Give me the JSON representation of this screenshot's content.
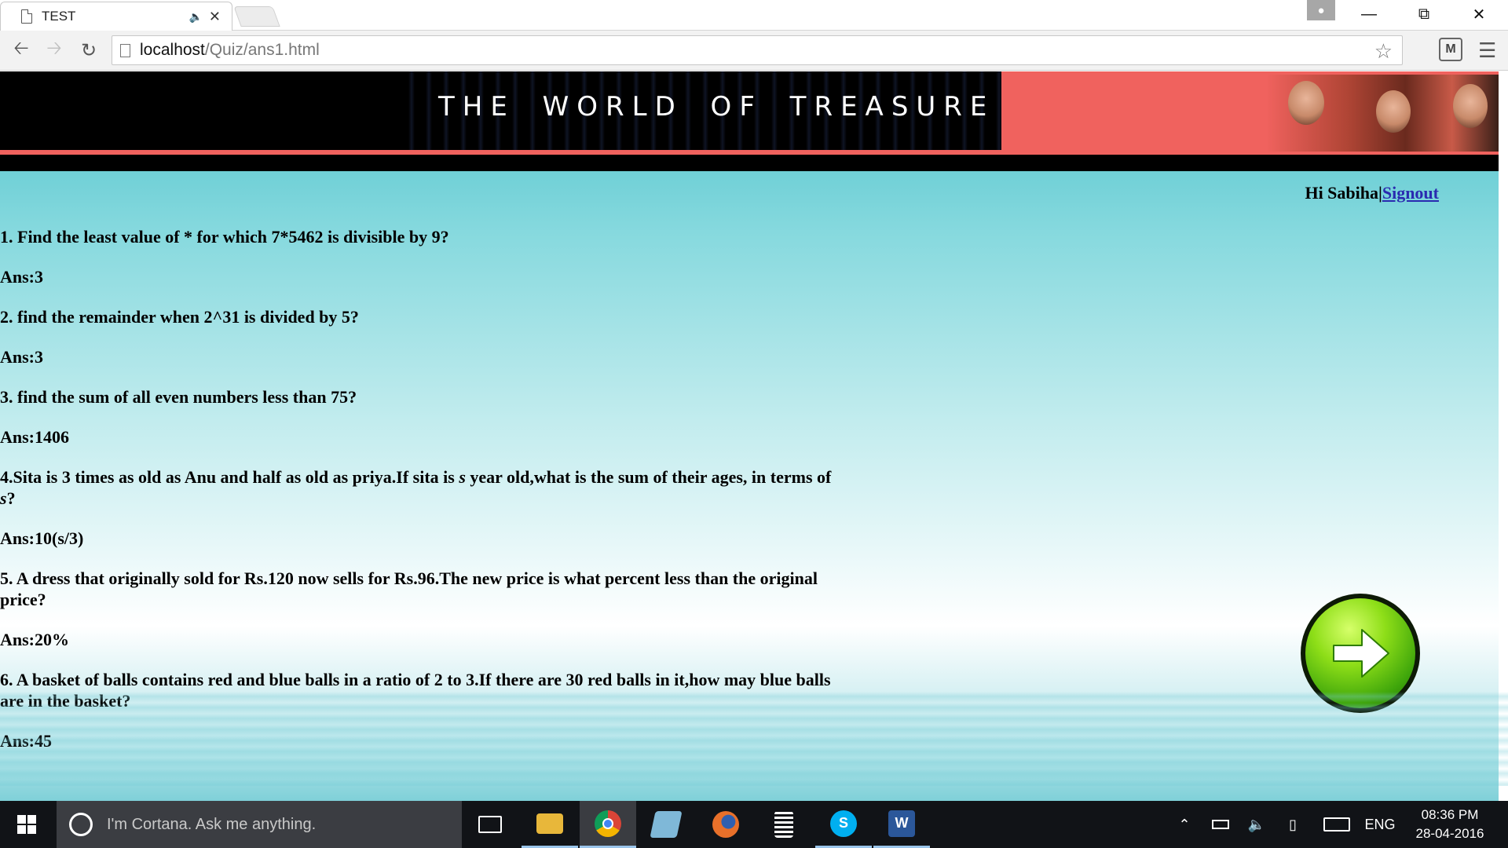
{
  "browser": {
    "tab_title": "TEST",
    "url_host": "localhost",
    "url_path": "/Quiz/ans1.html"
  },
  "site": {
    "title": "THE WORLD OF TREASURE",
    "greeting": "Hi Sabiha|",
    "signout": "Signout"
  },
  "questions": [
    {
      "q": "1. Find the least value of * for which 7*5462 is divisible by 9?",
      "a": "Ans:3"
    },
    {
      "q": "2. find the remainder when 2^31 is divided by 5?",
      "a": "Ans:3"
    },
    {
      "q": "3. find the sum of all even numbers less than 75?",
      "a": "Ans:1406"
    },
    {
      "q1": "4.Sita is 3 times as old as Anu and half as old as priya.If sita is ",
      "qv1": "s",
      "q2": " year old,what is the sum of their ages, in terms of ",
      "qv2": "s",
      "q3": "?",
      "a": "Ans:10(s/3)"
    },
    {
      "q": "5. A dress that originally sold for Rs.120 now sells for Rs.96.The new price is what percent less than the original price?",
      "a": "Ans:20%"
    },
    {
      "q": "6. A basket of balls contains red and blue balls in a ratio of 2 to 3.If there are 30 red balls in it,how may blue balls are in the basket?",
      "a": "Ans:45"
    }
  ],
  "taskbar": {
    "cortana_placeholder": "I'm Cortana. Ask me anything.",
    "language": "ENG",
    "time": "08:36 PM",
    "date": "28-04-2016"
  },
  "icons": {
    "next": "green-arrow-right-icon",
    "start": "windows-logo-icon"
  }
}
